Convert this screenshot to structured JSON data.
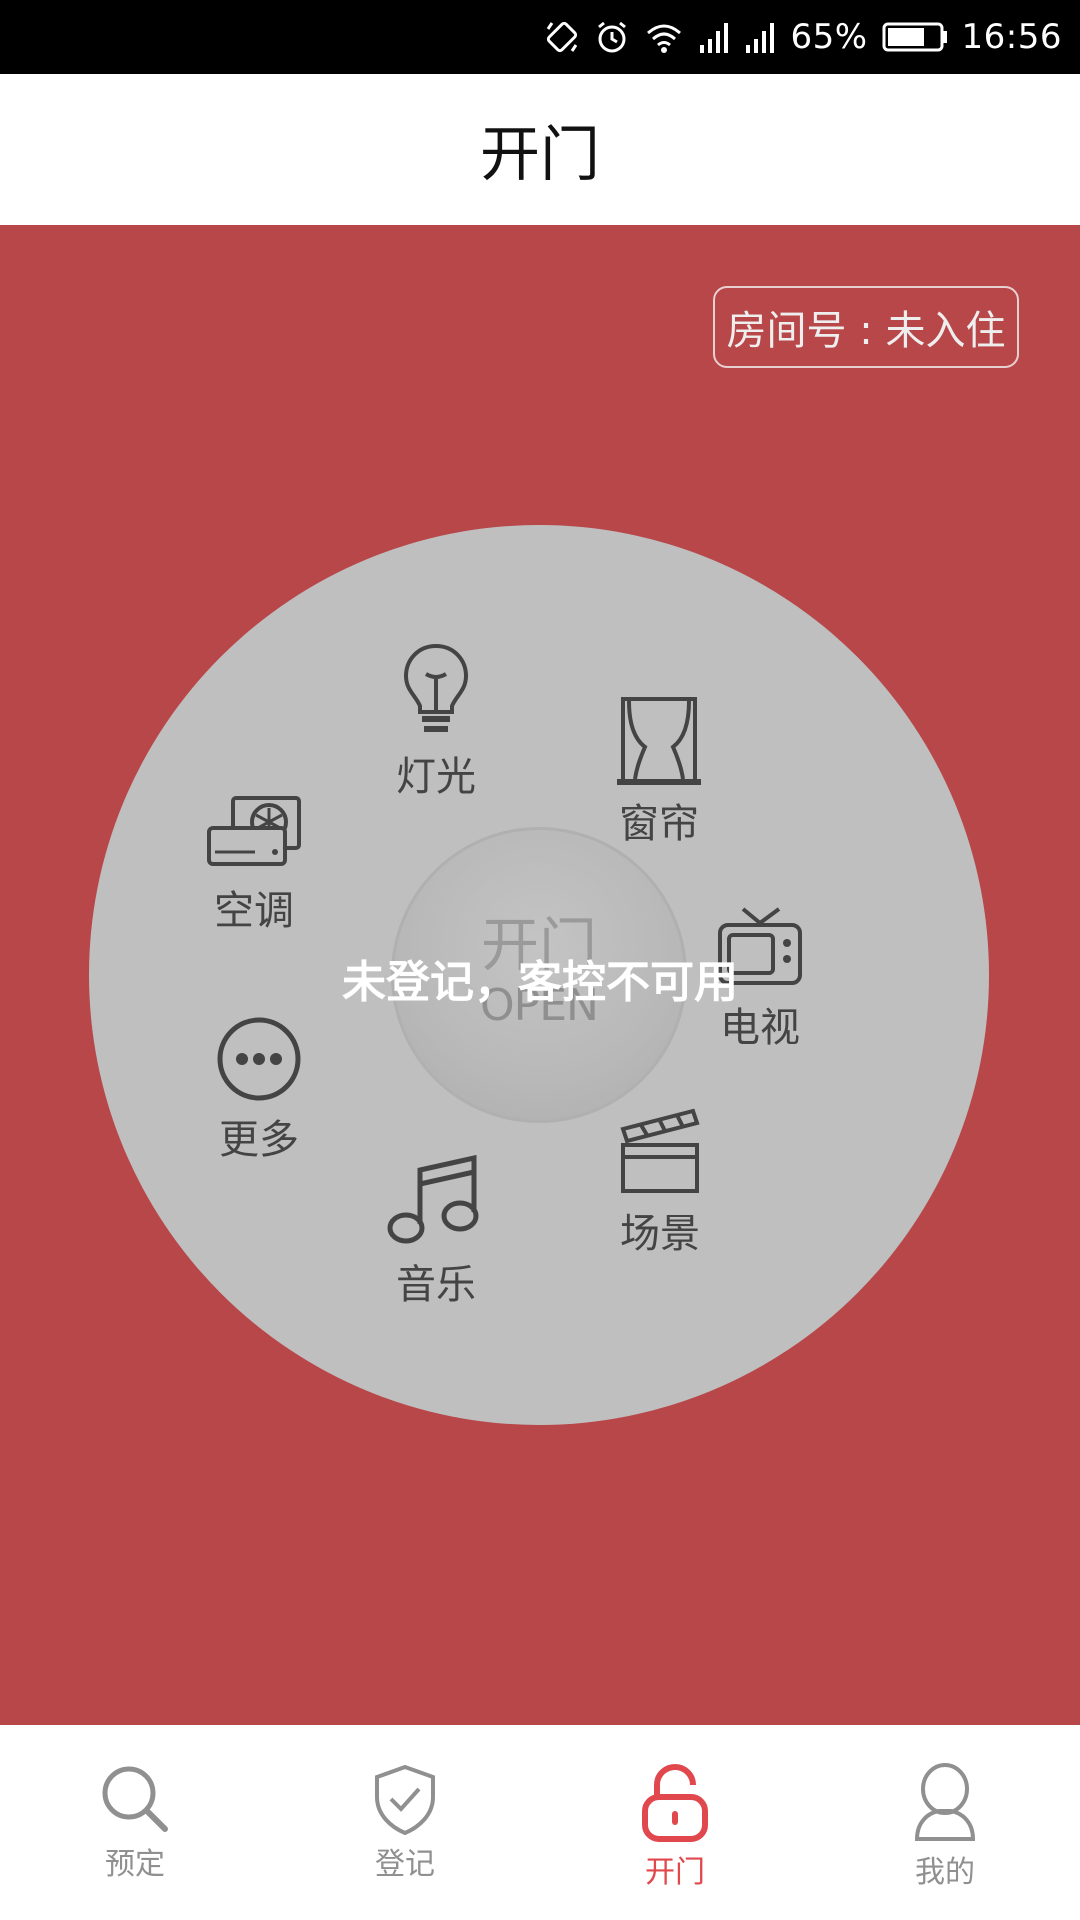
{
  "status_bar": {
    "battery": "65%",
    "time": "16:56"
  },
  "header": {
    "title": "开门"
  },
  "room": {
    "label": "房间号 : 未入住"
  },
  "controls": {
    "light": {
      "label": "灯光",
      "icon": "light-bulb-icon"
    },
    "curtain": {
      "label": "窗帘",
      "icon": "curtain-icon"
    },
    "aircon": {
      "label": "空调",
      "icon": "air-conditioner-icon"
    },
    "tv": {
      "label": "电视",
      "icon": "tv-icon"
    },
    "more": {
      "label": "更多",
      "icon": "more-icon"
    },
    "scene": {
      "label": "场景",
      "icon": "clapperboard-icon"
    },
    "music": {
      "label": "音乐",
      "icon": "music-note-icon"
    }
  },
  "open_button": {
    "label_cn": "开门",
    "label_en": "OPEN"
  },
  "overlay_message": "未登记，客控不可用",
  "bottom_nav": {
    "items": [
      {
        "label": "预定",
        "icon": "search-icon",
        "active": false
      },
      {
        "label": "登记",
        "icon": "shield-check-icon",
        "active": false
      },
      {
        "label": "开门",
        "icon": "unlock-icon",
        "active": true
      },
      {
        "label": "我的",
        "icon": "user-icon",
        "active": false
      }
    ]
  },
  "colors": {
    "main_background": "#b8474a",
    "disc": "#bfbfbf",
    "active_tab": "#e0484e",
    "inactive_tab": "#909090"
  }
}
